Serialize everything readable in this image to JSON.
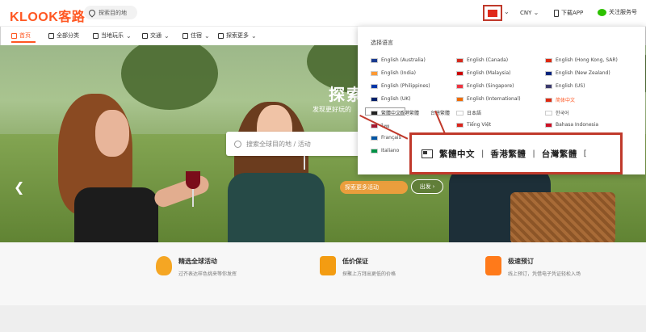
{
  "header": {
    "logo": "KLOOK客路",
    "destination": "探索目的地",
    "currency": "CNY",
    "app_label": "下载APP",
    "wechat_label": "关注服务号"
  },
  "nav": {
    "items": [
      {
        "label": "首页",
        "active": true
      },
      {
        "label": "全部分类"
      },
      {
        "label": "当地玩乐"
      },
      {
        "label": "交通"
      },
      {
        "label": "住宿"
      },
      {
        "label": "探索更多"
      }
    ]
  },
  "hero": {
    "title": "探索",
    "subtitle": "发现更好玩的",
    "search_placeholder": "搜索全球目的地 / 活动",
    "explore_text": "探索更多活动",
    "explore_button": "出发"
  },
  "language_menu": {
    "title": "选择语言",
    "items": [
      {
        "label": "English (Australia)",
        "flag": "#1a3b8f"
      },
      {
        "label": "English (Canada)",
        "flag": "#d52b1e"
      },
      {
        "label": "English (Hong Kong, SAR)",
        "flag": "#de2910"
      },
      {
        "label": "English (India)",
        "flag": "#ff9933"
      },
      {
        "label": "English (Malaysia)",
        "flag": "#cc0001"
      },
      {
        "label": "English (New Zealand)",
        "flag": "#00247d"
      },
      {
        "label": "English (Philippines)",
        "flag": "#0038a8"
      },
      {
        "label": "English (Singapore)",
        "flag": "#ef3340"
      },
      {
        "label": "English (US)",
        "flag": "#3c3b6e"
      },
      {
        "label": "English (UK)",
        "flag": "#012169"
      },
      {
        "label": "English (International)",
        "flag": "#ef6c00"
      },
      {
        "label": "简体中文",
        "flag": "#de2910",
        "selected": true
      },
      {
        "label": "繁體中文",
        "flag": "#222222"
      },
      {
        "label": "香港繁體",
        "flag": ""
      },
      {
        "label": "台灣繁體",
        "flag": ""
      },
      {
        "label": "日本語",
        "flag": "#ffffff"
      },
      {
        "label": "한국어",
        "flag": "#ffffff"
      },
      {
        "label": "ไทย",
        "flag": "#a51931"
      },
      {
        "label": "Tiếng Việt",
        "flag": "#da251d"
      },
      {
        "label": "Bahasa Indonesia",
        "flag": "#ce1126"
      },
      {
        "label": "Français",
        "flag": "#0055a4"
      },
      {
        "label": "Italiano",
        "flag": "#009246"
      }
    ]
  },
  "zoom_callout": {
    "item1": "繁體中文",
    "item2": "香港繁體",
    "sep": "|",
    "item3": "台灣繁體",
    "trailing": "["
  },
  "features": [
    {
      "title": "精选全球活动",
      "desc": "过齐表达样色挑来等你发挥",
      "color": "#f5a623"
    },
    {
      "title": "低价保证",
      "desc": "探聚上方拜出更低的价格",
      "color": "#f39c12"
    },
    {
      "title": "极速预订",
      "desc": "线上预订，凭借电子凭证轻松入场",
      "color": "#ff7a1a"
    }
  ]
}
